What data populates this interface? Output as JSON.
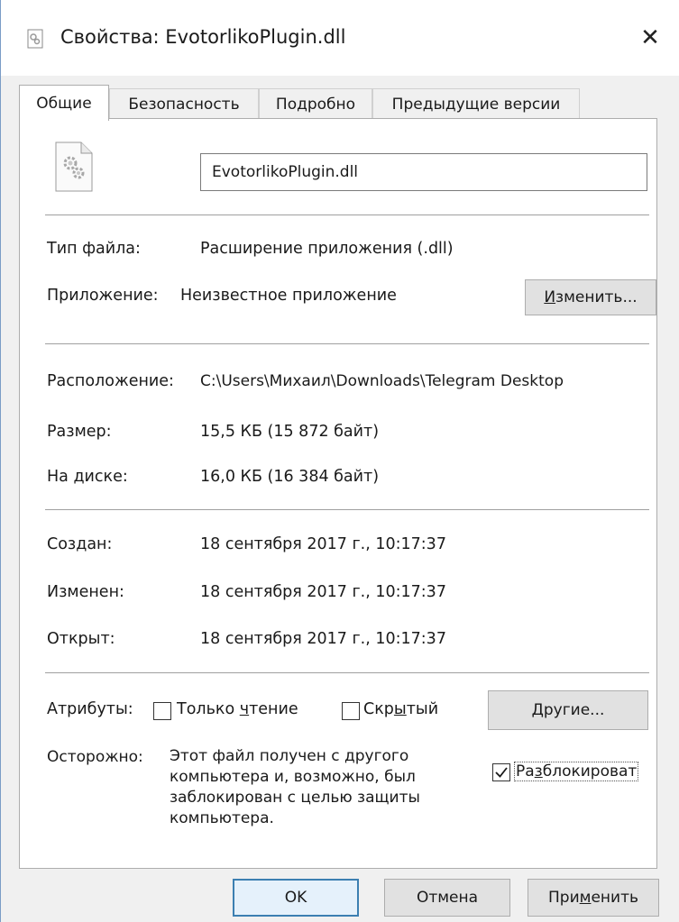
{
  "window": {
    "title": "Свойства: EvotorlikoPlugin.dll",
    "close_icon": "✕"
  },
  "tabs": [
    {
      "label": "Общие",
      "active": true
    },
    {
      "label": "Безопасность",
      "active": false
    },
    {
      "label": "Подробно",
      "active": false
    },
    {
      "label": "Предыдущие версии",
      "active": false
    }
  ],
  "general": {
    "file_name": "EvotorlikoPlugin.dll",
    "file_icon": "dll-gear-icon",
    "file_type_label": "Тип файла:",
    "file_type_value": "Расширение приложения (.dll)",
    "app_label": "Приложение:",
    "app_value": "Неизвестное приложение",
    "change_button": {
      "pre": "",
      "ul": "И",
      "post": "зменить..."
    },
    "location_label": "Расположение:",
    "location_value": "C:\\Users\\Михаил\\Downloads\\Telegram Desktop",
    "size_label": "Размер:",
    "size_value": "15,5 КБ (15 872 байт)",
    "disk_label": "На диске:",
    "disk_value": "16,0 КБ (16 384 байт)",
    "created_label": "Создан:",
    "created_value": "18 сентября 2017 г., 10:17:37",
    "modified_label": "Изменен:",
    "modified_value": "18 сентября 2017 г., 10:17:37",
    "opened_label": "Открыт:",
    "opened_value": "18 сентября 2017 г., 10:17:37",
    "attributes_label": "Атрибуты:",
    "readonly": {
      "pre": "Только ",
      "ul": "ч",
      "post": "тение",
      "checked": false
    },
    "hidden": {
      "pre": "Скр",
      "ul": "ы",
      "post": "тый",
      "checked": false
    },
    "other_button": {
      "pre": "",
      "ul": "Д",
      "post": "ругие..."
    },
    "warning_label": "Осторожно:",
    "warning_lines": [
      "Этот файл получен с другого",
      "компьютера и, возможно, был",
      "заблокирован с целью защиты",
      "компьютера."
    ],
    "unblock": {
      "pre": "Ра",
      "ul": "з",
      "post": "блокироват",
      "checked": true
    }
  },
  "footer": {
    "ok": "OK",
    "cancel": "Отмена",
    "apply": {
      "pre": "При",
      "ul": "м",
      "post": "енить"
    }
  },
  "colors": {
    "accent": "#3c7fb1",
    "panel_bg": "#ffffff",
    "window_bg": "#f0f0f0"
  }
}
